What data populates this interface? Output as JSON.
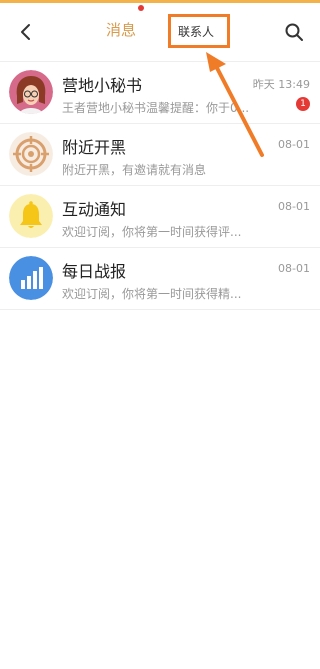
{
  "header": {
    "tabs": [
      {
        "label": "消息",
        "active": true
      },
      {
        "label": "联系人",
        "active": false
      }
    ]
  },
  "colors": {
    "accent": "#d99a4b",
    "highlight": "#f07c28",
    "badge": "#e53935"
  },
  "messages": [
    {
      "name": "营地小秘书",
      "preview": "王者营地小秘书温馨提醒：你于0...",
      "time": "昨天 13:49",
      "badge": "1",
      "avatar_icon": "girl-avatar-icon"
    },
    {
      "name": "附近开黑",
      "preview": "附近开黑，有邀请就有消息",
      "time": "08-01",
      "avatar_icon": "target-icon"
    },
    {
      "name": "互动通知",
      "preview": "欢迎订阅，你将第一时间获得评...",
      "time": "08-01",
      "avatar_icon": "bell-icon"
    },
    {
      "name": "每日战报",
      "preview": "欢迎订阅，你将第一时间获得精...",
      "time": "08-01",
      "avatar_icon": "bar-chart-icon"
    }
  ]
}
